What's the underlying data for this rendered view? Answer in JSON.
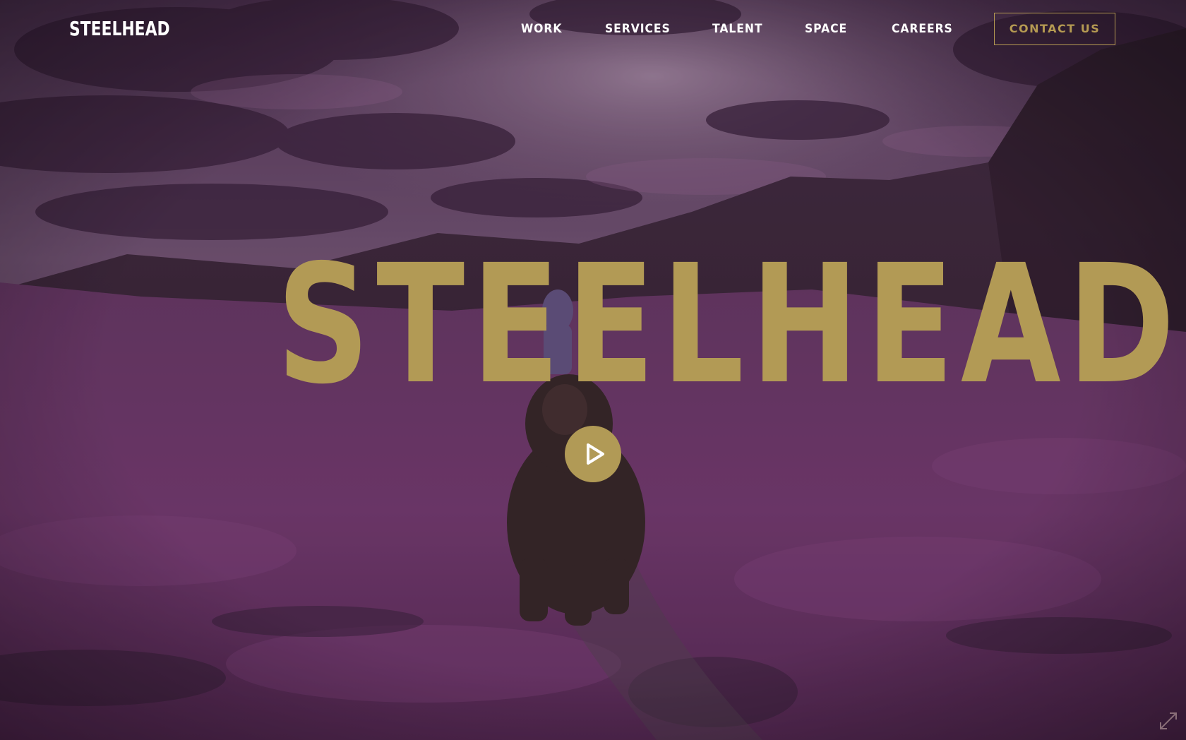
{
  "header": {
    "logo_text": "STEELHEAD",
    "nav": {
      "work": "WORK",
      "services": "SERVICES",
      "talent": "TALENT",
      "space": "SPACE",
      "careers": "CAREERS"
    },
    "contact_label": "CONTACT US"
  },
  "hero": {
    "title": "STEELHEAD",
    "play_icon": "play-icon",
    "fullscreen_icon": "expand-icon"
  },
  "colors": {
    "gold": "#b29a55",
    "nav_text": "#ffffff",
    "purple_field": "#7a3a78"
  }
}
